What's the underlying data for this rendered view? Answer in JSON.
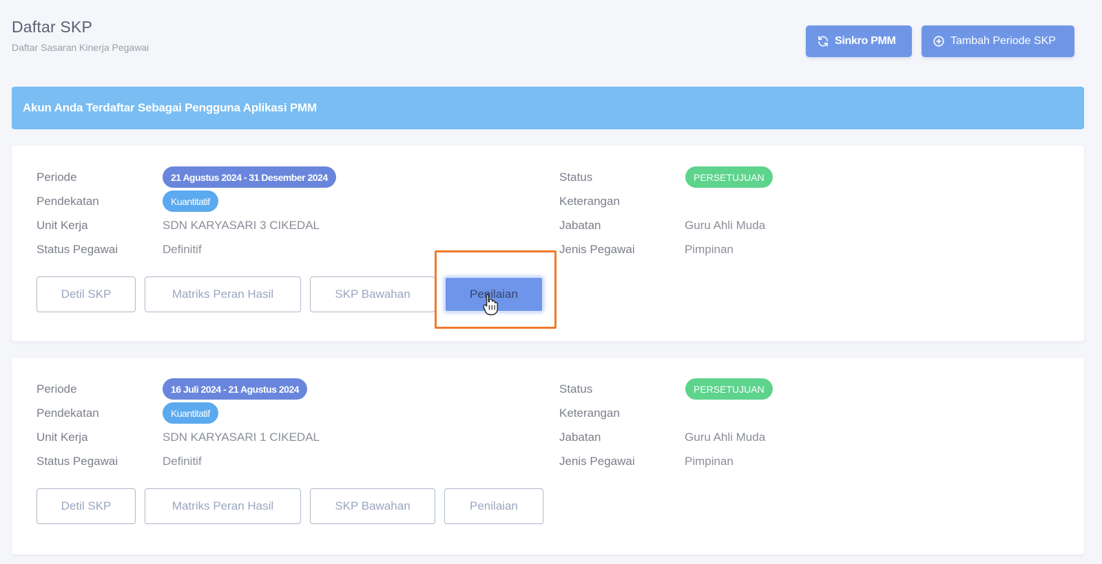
{
  "header": {
    "title": "Daftar SKP",
    "subtitle": "Daftar Sasaran Kinerja Pegawai",
    "sync_label": "Sinkro PMM",
    "add_label": "Tambah Periode SKP"
  },
  "alert": {
    "text": "Akun Anda Terdaftar Sebagai Pengguna Aplikasi PMM"
  },
  "labels": {
    "periode": "Periode",
    "pendekatan": "Pendekatan",
    "unit_kerja": "Unit Kerja",
    "status_pegawai": "Status Pegawai",
    "status": "Status",
    "keterangan": "Keterangan",
    "jabatan": "Jabatan",
    "jenis_pegawai": "Jenis Pegawai"
  },
  "buttons": {
    "detil": "Detil SKP",
    "matriks": "Matriks Peran Hasil",
    "bawahan": "SKP Bawahan",
    "penilaian": "Penilaian"
  },
  "cards": [
    {
      "periode": "21 Agustus 2024 - 31 Desember 2024",
      "pendekatan": "Kuantitatif",
      "unit_kerja": "SDN KARYASARI 3 CIKEDAL",
      "status_pegawai": "Definitif",
      "status": "PERSETUJUAN",
      "keterangan": "",
      "jabatan": "Guru Ahli Muda",
      "jenis_pegawai": "Pimpinan"
    },
    {
      "periode": "16 Juli 2024 - 21 Agustus 2024",
      "pendekatan": "Kuantitatif",
      "unit_kerja": "SDN KARYASARI 1 CIKEDAL",
      "status_pegawai": "Definitif",
      "status": "PERSETUJUAN",
      "keterangan": "",
      "jabatan": "Guru Ahli Muda",
      "jenis_pegawai": "Pimpinan"
    }
  ],
  "icons": {
    "sync": "refresh-icon",
    "add": "plus-circle-icon",
    "cursor": "hand-pointer-icon"
  },
  "colors": {
    "primary": "#6f96e6",
    "alert": "#79bdf2",
    "success": "#5dd38c",
    "highlight": "#f07a2a"
  }
}
